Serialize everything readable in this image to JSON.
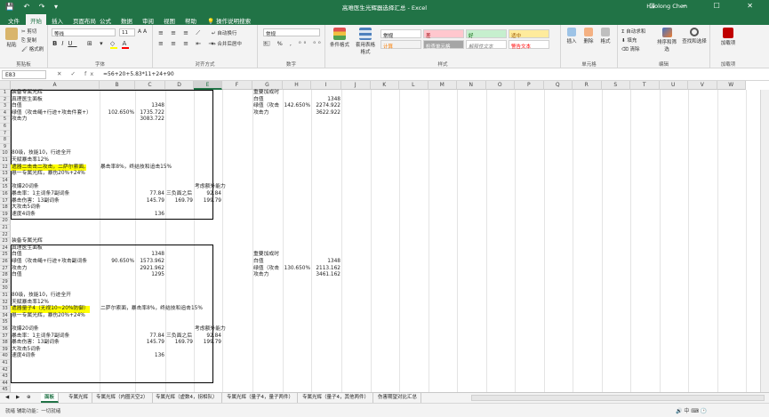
{
  "titlebar": {
    "qat_icons": [
      "save-icon",
      "undo-icon",
      "redo-icon"
    ],
    "qat_text": "💾 ↶ ↷ ▾",
    "title": "高难医生光辉器选择汇总  -  Excel",
    "user": "Haolong Chen",
    "window_buttons": "⊡ ─ ☐ ✕"
  },
  "tabs": [
    {
      "label": "文件"
    },
    {
      "label": "开始"
    },
    {
      "label": "插入"
    },
    {
      "label": "页面布局"
    },
    {
      "label": "公式"
    },
    {
      "label": "数据"
    },
    {
      "label": "审阅"
    },
    {
      "label": "视图"
    },
    {
      "label": "帮助"
    },
    {
      "label": "操作说明搜索"
    }
  ],
  "ribbon": {
    "paste": "粘贴",
    "cut": "剪切",
    "copy": "复制",
    "format_painter": "格式刷",
    "clipboard_group": "剪贴板",
    "font_name": "等线",
    "font_size": "11",
    "font_group": "字体",
    "wrap_text": "自动换行",
    "merge_center": "合并后居中",
    "alignment_group": "对齐方式",
    "number_format": "常规",
    "number_group": "数字",
    "conditional_format": "条件格式",
    "format_as_table": "套用表格格式",
    "styles": [
      {
        "label": "常规",
        "bg": "#ffffff",
        "color": "#000000"
      },
      {
        "label": "差",
        "bg": "#ffc7ce",
        "color": "#9c0006"
      },
      {
        "label": "好",
        "bg": "#c6efce",
        "color": "#006100"
      },
      {
        "label": "适中",
        "bg": "#ffeb9c",
        "color": "#9c5700"
      },
      {
        "label": "计算",
        "bg": "#f2f2f2",
        "color": "#fa7d00"
      },
      {
        "label": "检查单元格",
        "bg": "#a5a5a5",
        "color": "#ffffff"
      },
      {
        "label": "解释性文本",
        "bg": "#ffffff",
        "color": "#7f7f7f"
      },
      {
        "label": "警告文本",
        "bg": "#ffffff",
        "color": "#ff0000"
      }
    ],
    "styles_group": "样式",
    "insert": "插入",
    "delete": "删除",
    "format": "格式",
    "cells_group": "单元格",
    "autosum": "自动求和",
    "fill": "填充",
    "clear": "清除",
    "sort_filter": "排序和筛选",
    "find_select": "查找和选择",
    "editing_group": "编辑",
    "addins": "加载项",
    "addins_group": "加载项"
  },
  "formula_bar": {
    "name_box": "E83",
    "fx_text": "✕ ✓ fx",
    "formula": "=56+20+5.83*11+24+90"
  },
  "columns": [
    "A",
    "B",
    "C",
    "D",
    "E",
    "F",
    "G",
    "H",
    "I",
    "J",
    "K",
    "L",
    "M",
    "N",
    "O",
    "P",
    "Q",
    "R",
    "S",
    "T",
    "U",
    "V",
    "W"
  ],
  "rows": [
    "1",
    "2",
    "3",
    "4",
    "5",
    "6",
    "7",
    "8",
    "9",
    "10",
    "11",
    "12",
    "13",
    "14",
    "15",
    "16",
    "17",
    "18",
    "19",
    "20",
    "21",
    "22",
    "23",
    "24",
    "25",
    "26",
    "27",
    "28",
    "29",
    "30",
    "31",
    "32",
    "33",
    "34",
    "35",
    "36",
    "37",
    "38",
    "39",
    "40",
    "41",
    "42",
    "43",
    "44",
    "45"
  ],
  "cells": [
    {
      "row": 1,
      "col": "A",
      "text": "装备专属光辉"
    },
    {
      "row": 2,
      "col": "A",
      "text": "真理医生面板"
    },
    {
      "row": 3,
      "col": "A",
      "text": "白值"
    },
    {
      "row": 3,
      "col": "C",
      "text": "1348",
      "align": "r"
    },
    {
      "row": 4,
      "col": "A",
      "text": "绿值（攻击绳+行迹+攻击件套+）"
    },
    {
      "row": 4,
      "col": "B",
      "text": "102.650%",
      "align": "r"
    },
    {
      "row": 4,
      "col": "C",
      "text": "1735.722",
      "align": "r"
    },
    {
      "row": 5,
      "col": "A",
      "text": "攻击力"
    },
    {
      "row": 5,
      "col": "C",
      "text": "3083.722",
      "align": "r"
    },
    {
      "row": 10,
      "col": "A",
      "text": "80级，技能10，行迹全开"
    },
    {
      "row": 11,
      "col": "A",
      "text": "天赋暴击率12%"
    },
    {
      "row": 12,
      "col": "A",
      "text": "遗器二击击二攻击，二萨尔索面,",
      "hl": true
    },
    {
      "row": 12,
      "col": "B",
      "text": "暴击率8%，终结技和追击15%"
    },
    {
      "row": 13,
      "col": "A",
      "text": "悬一专属光辉，暴伤20%+24%"
    },
    {
      "row": 15,
      "col": "A",
      "text": "攻爆20词条"
    },
    {
      "row": 15,
      "col": "E",
      "text": "考虑额外能力"
    },
    {
      "row": 16,
      "col": "A",
      "text": "暴击率：1主词条7副词条"
    },
    {
      "row": 16,
      "col": "C",
      "text": "77.84",
      "align": "r"
    },
    {
      "row": 16,
      "col": "D",
      "text": "三负面之后"
    },
    {
      "row": 16,
      "col": "E",
      "text": "92.84",
      "align": "r"
    },
    {
      "row": 17,
      "col": "A",
      "text": "暴击伤害：13副词条"
    },
    {
      "row": 17,
      "col": "C",
      "text": "145.79",
      "align": "r"
    },
    {
      "row": 17,
      "col": "D",
      "text": "169.79",
      "align": "r"
    },
    {
      "row": 17,
      "col": "E",
      "text": "199.79",
      "align": "r"
    },
    {
      "row": 18,
      "col": "A",
      "text": "大攻击5词条"
    },
    {
      "row": 19,
      "col": "A",
      "text": "速度4词条"
    },
    {
      "row": 19,
      "col": "C",
      "text": "136",
      "align": "r"
    },
    {
      "row": 1,
      "col": "G",
      "text": "重要加成时"
    },
    {
      "row": 2,
      "col": "G",
      "text": "白值"
    },
    {
      "row": 2,
      "col": "I",
      "text": "1348",
      "align": "r"
    },
    {
      "row": 3,
      "col": "G",
      "text": "绿值（攻击"
    },
    {
      "row": 3,
      "col": "H",
      "text": "142.650%",
      "align": "r"
    },
    {
      "row": 3,
      "col": "I",
      "text": "2274.922",
      "align": "r"
    },
    {
      "row": 4,
      "col": "G",
      "text": "攻击力"
    },
    {
      "row": 4,
      "col": "I",
      "text": "3622.922",
      "align": "r"
    },
    {
      "row": 23,
      "col": "A",
      "text": "装备专属光辉"
    },
    {
      "row": 24,
      "col": "A",
      "text": "真理医生面板"
    },
    {
      "row": 25,
      "col": "A",
      "text": "白值"
    },
    {
      "row": 25,
      "col": "C",
      "text": "1348",
      "align": "r"
    },
    {
      "row": 26,
      "col": "A",
      "text": "绿值（攻击绳+行迹+攻击副词条"
    },
    {
      "row": 26,
      "col": "B",
      "text": "90.650%",
      "align": "r"
    },
    {
      "row": 26,
      "col": "C",
      "text": "1573.962",
      "align": "r"
    },
    {
      "row": 27,
      "col": "A",
      "text": "攻击力"
    },
    {
      "row": 27,
      "col": "C",
      "text": "2921.962",
      "align": "r"
    },
    {
      "row": 28,
      "col": "A",
      "text": "白值"
    },
    {
      "row": 28,
      "col": "C",
      "text": "1295",
      "align": "r"
    },
    {
      "row": 31,
      "col": "A",
      "text": "80级，技能10，行迹全开"
    },
    {
      "row": 32,
      "col": "A",
      "text": "天赋暴击率12%"
    },
    {
      "row": 33,
      "col": "A",
      "text": "遗器量子4（无视10~20%防御）",
      "hl": true
    },
    {
      "row": 33,
      "col": "B",
      "text": "二萨尔索面，暴击率8%，终结技和追击15%"
    },
    {
      "row": 34,
      "col": "A",
      "text": "悬一专属光辉，暴伤20%+24%"
    },
    {
      "row": 36,
      "col": "A",
      "text": "攻爆20词条"
    },
    {
      "row": 36,
      "col": "E",
      "text": "考虑额外能力"
    },
    {
      "row": 37,
      "col": "A",
      "text": "暴击率：1主词条7副词条"
    },
    {
      "row": 37,
      "col": "C",
      "text": "77.84",
      "align": "r"
    },
    {
      "row": 37,
      "col": "D",
      "text": "三负面之后"
    },
    {
      "row": 37,
      "col": "E",
      "text": "92.84",
      "align": "r"
    },
    {
      "row": 38,
      "col": "A",
      "text": "暴击伤害：13副词条"
    },
    {
      "row": 38,
      "col": "C",
      "text": "145.79",
      "align": "r"
    },
    {
      "row": 38,
      "col": "D",
      "text": "169.79",
      "align": "r"
    },
    {
      "row": 38,
      "col": "E",
      "text": "199.79",
      "align": "r"
    },
    {
      "row": 39,
      "col": "A",
      "text": "大攻击5词条"
    },
    {
      "row": 40,
      "col": "A",
      "text": "速度4词条"
    },
    {
      "row": 40,
      "col": "C",
      "text": "136",
      "align": "r"
    },
    {
      "row": 25,
      "col": "G",
      "text": "重要加成时"
    },
    {
      "row": 26,
      "col": "G",
      "text": "白值"
    },
    {
      "row": 26,
      "col": "I",
      "text": "1348",
      "align": "r"
    },
    {
      "row": 27,
      "col": "G",
      "text": "绿值（攻击"
    },
    {
      "row": 27,
      "col": "H",
      "text": "130.650%",
      "align": "r"
    },
    {
      "row": 27,
      "col": "I",
      "text": "2113.162",
      "align": "r"
    },
    {
      "row": 28,
      "col": "G",
      "text": "攻击力"
    },
    {
      "row": 28,
      "col": "I",
      "text": "3461.162",
      "align": "r"
    }
  ],
  "sheet_tabs": [
    {
      "label": "面板",
      "active": true
    },
    {
      "label": "专属光辉"
    },
    {
      "label": "专属光辉（内圈天空2）"
    },
    {
      "label": "专属光辉（虚数4，拐相队）"
    },
    {
      "label": "专属光辉（量子4，量子两件）"
    },
    {
      "label": "专属光辉（量子4，其他两件）"
    },
    {
      "label": "伤害期望对比汇总"
    }
  ],
  "sheet_nav_text": "◀ ▶ ⊕",
  "status": "就绪  辅助功能：一切就绪",
  "system_tray": "🔊 中 ⌨ 🕑"
}
